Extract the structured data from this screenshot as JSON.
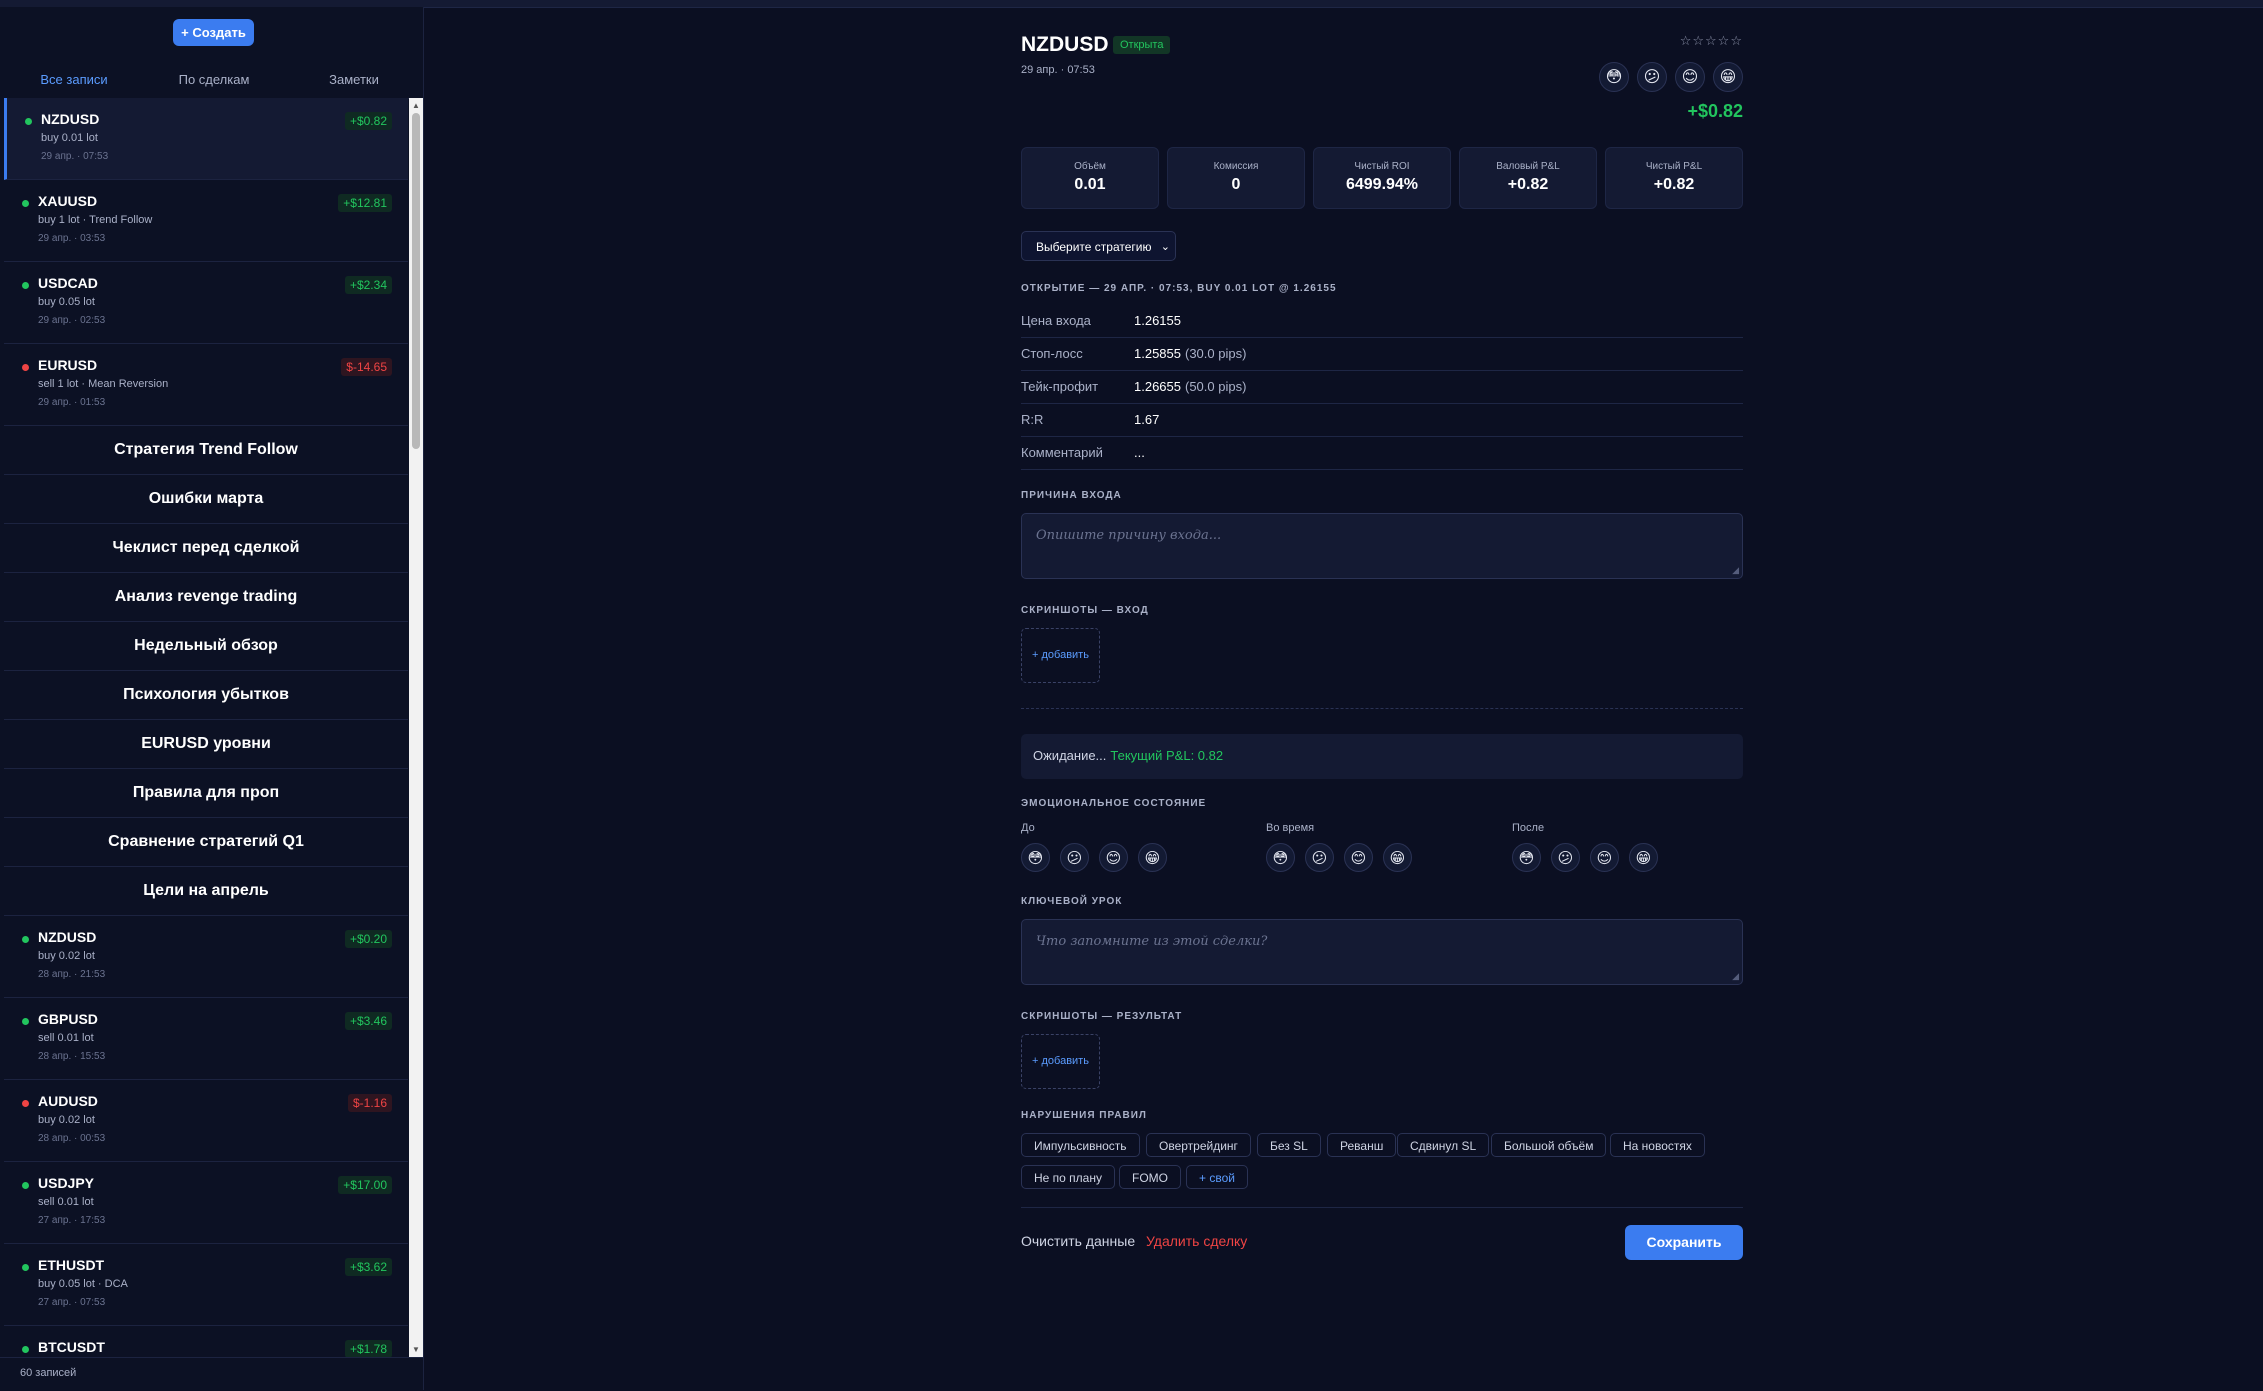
{
  "sidebar": {
    "create_label": "+ Создать",
    "tabs": [
      {
        "label": "Все записи",
        "active": true
      },
      {
        "label": "По сделкам",
        "active": false
      },
      {
        "label": "Заметки",
        "active": false
      }
    ],
    "items_top": [
      {
        "symbol": "NZDUSD",
        "info": "buy 0.01 lot",
        "date": "29 апр. · 07:53",
        "pnl": "+$0.82",
        "positive": true,
        "selected": true
      },
      {
        "symbol": "XAUUSD",
        "info": "buy 1 lot · Trend Follow",
        "date": "29 апр. · 03:53",
        "pnl": "+$12.81",
        "positive": true
      },
      {
        "symbol": "USDCAD",
        "info": "buy 0.05 lot",
        "date": "29 апр. · 02:53",
        "pnl": "+$2.34",
        "positive": true
      },
      {
        "symbol": "EURUSD",
        "info": "sell 1 lot · Mean Reversion",
        "date": "29 апр. · 01:53",
        "pnl": "$-14.65",
        "positive": false
      }
    ],
    "notes": [
      "Стратегия Trend Follow",
      "Ошибки марта",
      "Чеклист перед сделкой",
      "Анализ revenge trading",
      "Недельный обзор",
      "Психология убытков",
      "EURUSD уровни",
      "Правила для проп",
      "Сравнение стратегий Q1",
      "Цели на апрель"
    ],
    "items_bottom": [
      {
        "symbol": "NZDUSD",
        "info": "buy 0.02 lot",
        "date": "28 апр. · 21:53",
        "pnl": "+$0.20",
        "positive": true
      },
      {
        "symbol": "GBPUSD",
        "info": "sell 0.01 lot",
        "date": "28 апр. · 15:53",
        "pnl": "+$3.46",
        "positive": true
      },
      {
        "symbol": "AUDUSD",
        "info": "buy 0.02 lot",
        "date": "28 апр. · 00:53",
        "pnl": "$-1.16",
        "positive": false
      },
      {
        "symbol": "USDJPY",
        "info": "sell 0.01 lot",
        "date": "27 апр. · 17:53",
        "pnl": "+$17.00",
        "positive": true
      },
      {
        "symbol": "ETHUSDT",
        "info": "buy 0.05 lot · DCA",
        "date": "27 апр. · 07:53",
        "pnl": "+$3.62",
        "positive": true
      },
      {
        "symbol": "BTCUSDT",
        "info": "",
        "date": "",
        "pnl": "+$1.78",
        "positive": true
      }
    ],
    "count": "60 записей"
  },
  "detail": {
    "symbol": "NZDUSD",
    "status": "Открыта",
    "datetime": "29 апр. · 07:53",
    "stars": "☆☆☆☆☆",
    "rating": 0,
    "pnl": "+$0.82",
    "stats": [
      {
        "label": "Объём",
        "value": "0.01"
      },
      {
        "label": "Комиссия",
        "value": "0"
      },
      {
        "label": "Чистый ROI",
        "value": "6499.94%"
      },
      {
        "label": "Валовый P&L",
        "value": "+0.82"
      },
      {
        "label": "Чистый P&L",
        "value": "+0.82"
      }
    ],
    "strategy_select": "Выберите стратегию",
    "opening_title": "ОТКРЫТИЕ — 29 АПР. · 07:53, BUY 0.01 LOT @ 1.26155",
    "rows": [
      {
        "label": "Цена входа",
        "value": "1.26155",
        "extra": ""
      },
      {
        "label": "Стоп-лосс",
        "value": "1.25855",
        "extra": "(30.0 pips)"
      },
      {
        "label": "Тейк-профит",
        "value": "1.26655",
        "extra": "(50.0 pips)"
      },
      {
        "label": "R:R",
        "value": "1.67",
        "extra": ""
      },
      {
        "label": "Комментарий",
        "value": "...",
        "extra": ""
      }
    ],
    "entry_reason_title": "ПРИЧИНА ВХОДА",
    "entry_reason_placeholder": "Опишите причину входа...",
    "screens_entry_title": "СКРИНШОТЫ — ВХОД",
    "add_label": "+ добавить",
    "waiting_text": "Ожидание...",
    "waiting_pnl": "Текущий P&L: 0.82",
    "emotion_title": "ЭМОЦИОНАЛЬНОЕ СОСТОЯНИЕ",
    "emotion_groups": [
      "До",
      "Во время",
      "После"
    ],
    "lesson_title": "КЛЮЧЕВОЙ УРОК",
    "lesson_placeholder": "Что запомните из этой сделки?",
    "screens_result_title": "СКРИНШОТЫ — РЕЗУЛЬТАТ",
    "violations_title": "НАРУШЕНИЯ ПРАВИЛ",
    "tags": [
      "Импульсивность",
      "Овертрейдинг",
      "Без SL",
      "Реванш",
      "Сдвинул SL",
      "Большой объём",
      "На новостях",
      "Не по плану",
      "FOMO"
    ],
    "add_tag_label": "+ свой",
    "clear_label": "Очистить данные",
    "delete_label": "Удалить сделку",
    "save_label": "Сохранить"
  },
  "icons": {
    "emotions": [
      "😳",
      "😕",
      "😊",
      "😁"
    ],
    "resize": "◢",
    "chevron": "⌄"
  },
  "colors": {
    "accent": "#3b7cf0",
    "positive": "#22c55e",
    "negative": "#ef4444",
    "background": "#0b0f22"
  }
}
